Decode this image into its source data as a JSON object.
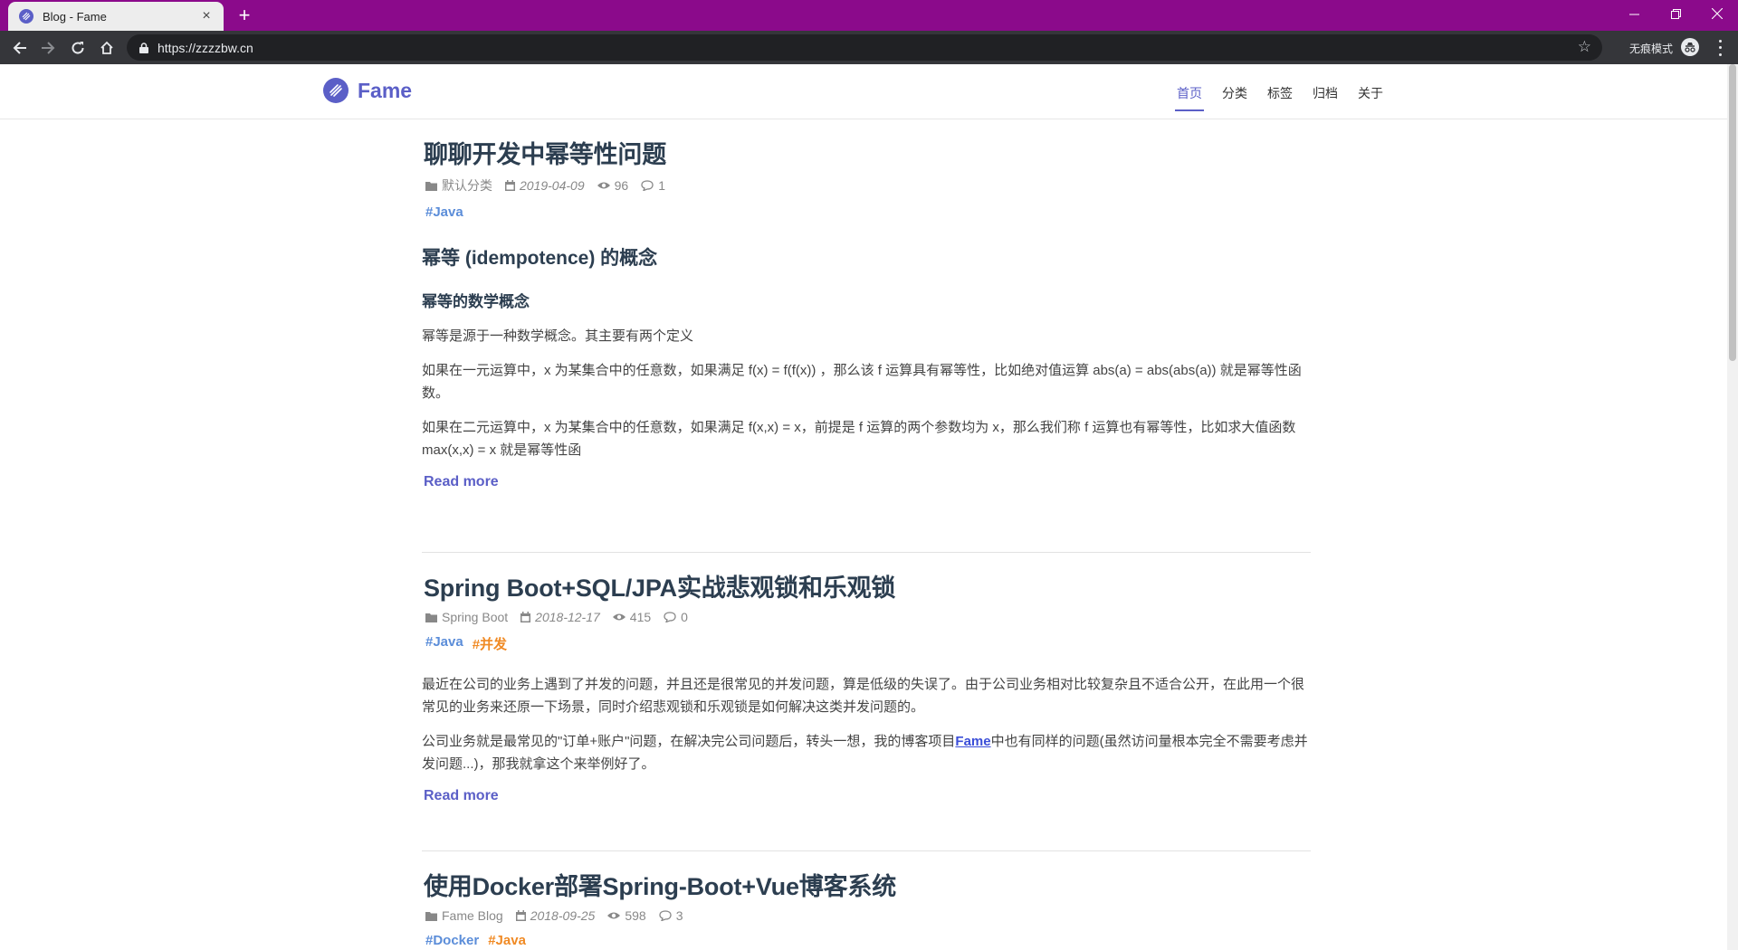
{
  "browser": {
    "tab_title": "Blog - Fame",
    "tab_close": "×",
    "new_tab": "+",
    "url": "https://zzzzbw.cn",
    "incognito_label": "无痕模式",
    "window_controls": [
      "—",
      "❐",
      "✕"
    ]
  },
  "site": {
    "logo_text": "Fame",
    "brand_color": "#5b5fc7",
    "nav": [
      {
        "label": "首页",
        "active": true
      },
      {
        "label": "分类",
        "active": false
      },
      {
        "label": "标签",
        "active": false
      },
      {
        "label": "归档",
        "active": false
      },
      {
        "label": "关于",
        "active": false
      }
    ]
  },
  "posts": [
    {
      "title": "聊聊开发中幂等性问题",
      "category": "默认分类",
      "date": "2019-04-09",
      "views": "96",
      "comments": "1",
      "tags": [
        "#Java"
      ],
      "h2": "幂等 (idempotence) 的概念",
      "h3": "幂等的数学概念",
      "paragraphs": [
        "幂等是源于一种数学概念。其主要有两个定义",
        "如果在一元运算中，x 为某集合中的任意数，如果满足 f(x) = f(f(x)) ，那么该 f 运算具有幂等性，比如绝对值运算 abs(a) = abs(abs(a)) 就是幂等性函数。",
        "如果在二元运算中，x 为某集合中的任意数，如果满足 f(x,x) = x，前提是 f 运算的两个参数均为 x，那么我们称 f 运算也有幂等性，比如求大值函数 max(x,x) = x 就是幂等性函"
      ],
      "read_more": "Read more"
    },
    {
      "title": "Spring Boot+SQL/JPA实战悲观锁和乐观锁",
      "category": "Spring Boot",
      "date": "2018-12-17",
      "views": "415",
      "comments": "0",
      "tags": [
        "#Java",
        "#并发"
      ],
      "paragraphs": [
        "最近在公司的业务上遇到了并发的问题，并且还是很常见的并发问题，算是低级的失误了。由于公司业务相对比较复杂且不适合公开，在此用一个很常见的业务来还原一下场景，同时介绍悲观锁和乐观锁是如何解决这类并发问题的。"
      ],
      "para2_before": "公司业务就是最常见的\"订单+账户\"问题，在解决完公司问题后，转头一想，我的博客项目",
      "para2_link": "Fame",
      "para2_after": "中也有同样的问题(虽然访问量根本完全不需要考虑并发问题...)，那我就拿这个来举例好了。",
      "read_more": "Read more"
    },
    {
      "title": "使用Docker部署Spring-Boot+Vue博客系统",
      "category": "Fame Blog",
      "date": "2018-09-25",
      "views": "598",
      "comments": "3",
      "tags": [
        "#Docker",
        "#Java"
      ]
    }
  ]
}
